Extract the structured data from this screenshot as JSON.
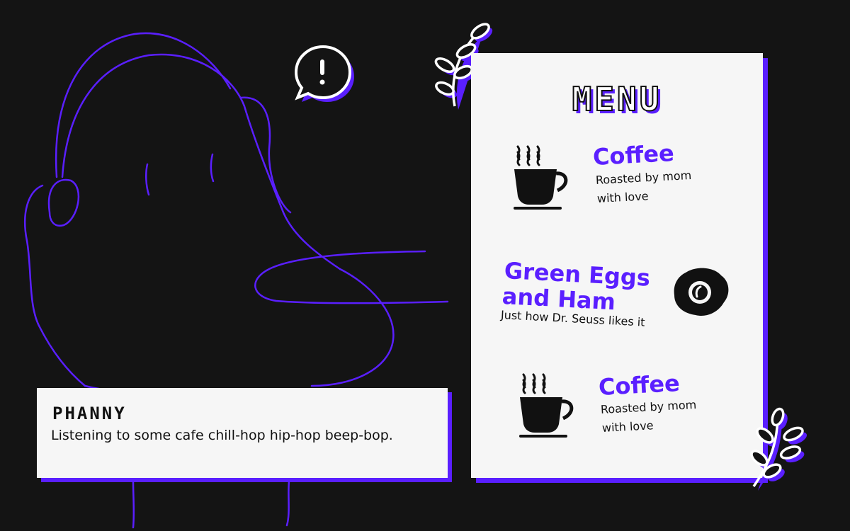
{
  "colors": {
    "background": "#141414",
    "accent": "#5a1fff",
    "panel": "#f6f6f6",
    "ink": "#111111"
  },
  "menu": {
    "title": "MENU",
    "items": [
      {
        "name": "Coffee",
        "description_line1": "Roasted by mom",
        "description_line2": "with love",
        "icon": "coffee-cup-icon"
      },
      {
        "name_line1": "Green Eggs",
        "name_line2": "and Ham",
        "description": "Just how Dr. Seuss likes it",
        "icon": "fried-egg-icon"
      },
      {
        "name": "Coffee",
        "description_line1": "Roasted by mom",
        "description_line2": "with love",
        "icon": "coffee-cup-icon"
      }
    ]
  },
  "dialog": {
    "speaker": "PHANNY",
    "text": "Listening to some cafe chill-hop hip-hop beep-bop."
  },
  "decorations": {
    "alert": "speech-bubble-exclamation-icon",
    "leaves": "leaf-sprig-icon"
  }
}
